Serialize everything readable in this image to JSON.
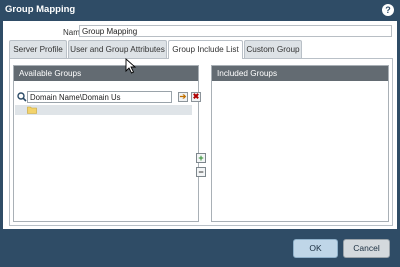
{
  "window": {
    "title": "Group Mapping",
    "help_icon": "help-icon"
  },
  "form": {
    "name_label": "Name",
    "name_value": "Group Mapping"
  },
  "tabs": [
    {
      "label": "Server Profile",
      "active": false
    },
    {
      "label": "User and Group Attributes",
      "active": false
    },
    {
      "label": "Group Include List",
      "active": true
    },
    {
      "label": "Custom Group",
      "active": false
    }
  ],
  "available_groups": {
    "header": "Available Groups",
    "search_value": "Domain Name\\Domain Us",
    "search_icon": "search-icon",
    "go_icon": "arrow-right-icon",
    "clear_icon": "close-icon",
    "tree_items": [
      {
        "icon": "folder-icon",
        "label": ""
      }
    ]
  },
  "included_groups": {
    "header": "Included Groups"
  },
  "controls": {
    "add_icon": "plus-icon",
    "remove_icon": "minus-icon"
  },
  "footer": {
    "ok_label": "OK",
    "cancel_label": "Cancel"
  },
  "colors": {
    "title_bar": "#2f4c66",
    "column_header": "#636b72",
    "ok_button": "#bfd6e8",
    "cancel_button": "#d4d9dd"
  }
}
